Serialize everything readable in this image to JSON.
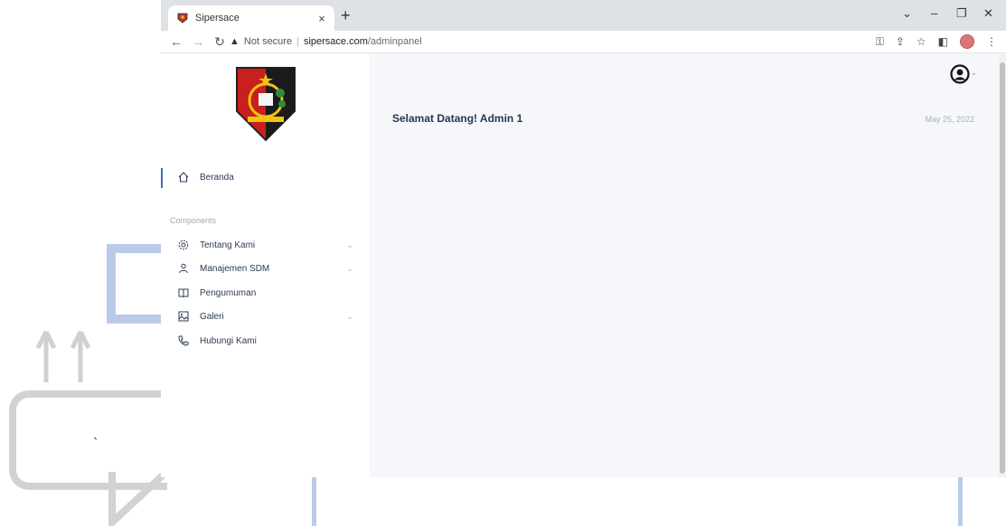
{
  "browser": {
    "tab_title": "Sipersace",
    "tab_close": "×",
    "new_tab": "+",
    "security_label": "Not secure",
    "url_host": "sipersace.com",
    "url_path": "/adminpanel"
  },
  "sidebar": {
    "home_label": "Beranda",
    "section_label": "Components",
    "items": [
      {
        "label": "Tentang Kami",
        "icon": "gear-icon",
        "has_chevron": true
      },
      {
        "label": "Manajemen SDM",
        "icon": "user-icon",
        "has_chevron": true
      },
      {
        "label": "Pengumuman",
        "icon": "book-icon",
        "has_chevron": false
      },
      {
        "label": "Galeri",
        "icon": "image-icon",
        "has_chevron": true
      },
      {
        "label": "Hubungi Kami",
        "icon": "phone-icon",
        "has_chevron": false
      }
    ]
  },
  "main": {
    "welcome": "Selamat Datang! Admin 1",
    "date": "May 25, 2022"
  },
  "decor": {
    "tick_mark": "`"
  },
  "colors": {
    "accent": "#3a6fb0",
    "main_bg": "#f5f7fa",
    "text_dark": "#253858",
    "text_muted": "#aab0bb"
  }
}
